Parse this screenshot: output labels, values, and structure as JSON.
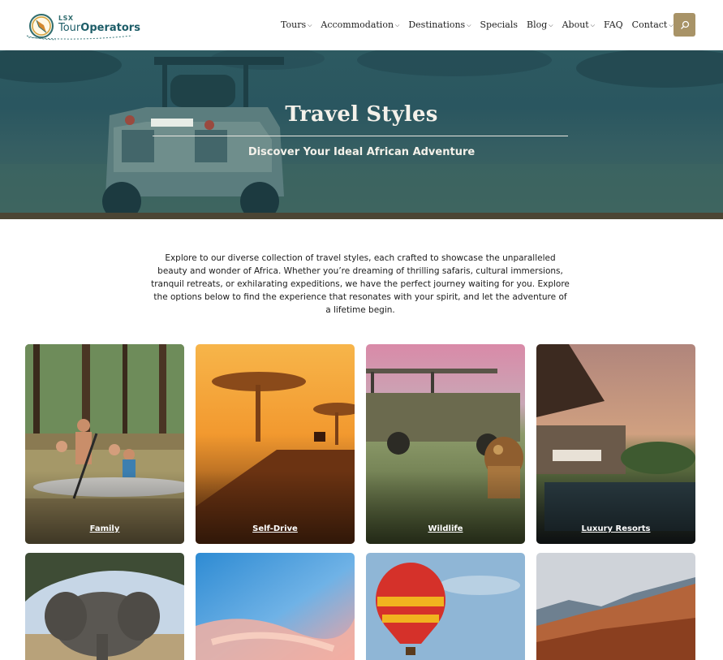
{
  "brand": {
    "small": "LSX",
    "name_light": "Tour",
    "name_bold": "Operators"
  },
  "nav": [
    {
      "label": "Tours",
      "has_dropdown": true
    },
    {
      "label": "Accommodation",
      "has_dropdown": true
    },
    {
      "label": "Destinations",
      "has_dropdown": true
    },
    {
      "label": "Specials",
      "has_dropdown": false
    },
    {
      "label": "Blog",
      "has_dropdown": true
    },
    {
      "label": "About",
      "has_dropdown": true
    },
    {
      "label": "FAQ",
      "has_dropdown": false
    },
    {
      "label": "Contact",
      "has_dropdown": true
    }
  ],
  "hero": {
    "title": "Travel Styles",
    "subtitle": "Discover Your Ideal African Adventure"
  },
  "intro": "Explore to our diverse collection of travel styles, each crafted to showcase the unparalleled beauty and wonder of Africa. Whether you’re dreaming of thrilling safaris, cultural immersions, tranquil retreats, or exhilarating expeditions, we have the perfect journey waiting for you. Explore the options below to find the experience that resonates with your spirit, and let the adventure of a lifetime begin.",
  "styles": [
    {
      "label": "Family"
    },
    {
      "label": "Self-Drive"
    },
    {
      "label": "Wildlife"
    },
    {
      "label": "Luxury Resorts"
    },
    {
      "label": ""
    },
    {
      "label": ""
    },
    {
      "label": ""
    },
    {
      "label": ""
    }
  ],
  "colors": {
    "accent": "#a89367",
    "hero_overlay": "#2d5a61",
    "divider": "#4b4534"
  }
}
